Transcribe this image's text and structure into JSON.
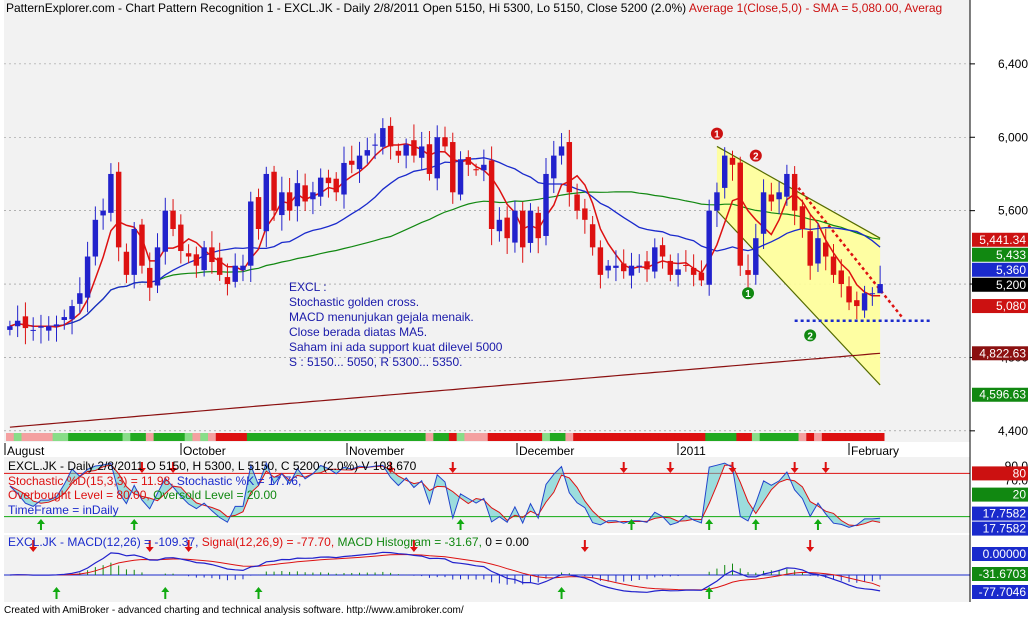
{
  "app": {
    "title": "PatternExplorer.com - Chart Pattern Recognition 1",
    "footer": "Created with AmiBroker - advanced charting and technical analysis software. http://www.amibroker.com/"
  },
  "colors": {
    "background": "#ffffff",
    "plot_bg": "#f2f2f2",
    "axis_bg": "#ffffff",
    "up_candle": "#2222cc",
    "down_candle": "#dd1111",
    "ma5": "#dd1111",
    "ma20": "#1a2acc",
    "ma50": "#118811",
    "ma200": "#8b1010",
    "wedge_fill": "#ffff99",
    "wedge_line": "#556b00",
    "annotation_text": "#1a1aaa",
    "stoch_d": "#dd1111",
    "stoch_k": "#2244cc",
    "stoch_fill": "#55cccc",
    "macd_line": "#2222cc",
    "signal_line": "#dd1111",
    "arrow_up": "#11aa11",
    "arrow_down": "#dd1111"
  },
  "panels": {
    "price": {
      "header": "PatternExplorer.com - Chart Pattern Recognition 1  - EXCL.JK - Daily 2/8/2011 Open 5150, Hi 5300, Lo 5150, Close 5200 (2.0%) ",
      "header_ma": "Average 1(Close,5,0) - SMA = 5,080.00, Averag",
      "annotation": [
        "EXCL :",
        "Stochastic golden cross.",
        "MACD menunjukan gejala menaik.",
        "Close berada diatas MA5.",
        "Saham ini ada support kuat dilevel 5000",
        "S : 5150... 5050, R 5300... 5350."
      ],
      "pattern_markers": [
        "1",
        "2",
        "1",
        "2"
      ],
      "x_labels": [
        "August",
        "October",
        "November",
        "December",
        "2011",
        "February"
      ],
      "y_ticks": [
        "6,400",
        "6,000",
        "5,600",
        "5,200",
        "4,800",
        "4,400"
      ],
      "value_tags": [
        {
          "text": "5,441.34",
          "bg": "#cc1111",
          "fg": "#ffffff"
        },
        {
          "text": "5,433",
          "bg": "#118811",
          "fg": "#ffffff"
        },
        {
          "text": "5,360",
          "bg": "#1a2acc",
          "fg": "#ffffff"
        },
        {
          "text": "5,200",
          "bg": "#000000",
          "fg": "#ffffff"
        },
        {
          "text": "5,080",
          "bg": "#cc1111",
          "fg": "#ffffff"
        },
        {
          "text": "4,822.63",
          "bg": "#8b1010",
          "fg": "#ffffff"
        },
        {
          "text": "4,596.63",
          "bg": "#118811",
          "fg": "#ffffff"
        }
      ]
    },
    "stochastic": {
      "line1": "EXCL.JK - Daily 2/8/2011 O 5150, H 5300, L 5150, C 5200 (2.0%) V 108,670",
      "line2_a": "Stochastic %D(15,3,3) = 11.98,",
      "line2_b": " Stochastic %K = 17.76,",
      "line3_a": "Overbought Level = 80.00,",
      "line3_b": " Oversold Level = 20.00",
      "line4": "TimeFrame = inDaily",
      "y_ticks": [
        "90.0",
        "70.0",
        "50.0"
      ],
      "value_tags": [
        {
          "text": "80",
          "bg": "#cc1111",
          "fg": "#ffffff"
        },
        {
          "text": "20",
          "bg": "#118811",
          "fg": "#ffffff"
        },
        {
          "text": "17.7582",
          "bg": "#1a2acc",
          "fg": "#ffffff"
        },
        {
          "text": "17.7582",
          "bg": "#1a2acc",
          "fg": "#ffffff"
        }
      ]
    },
    "macd": {
      "line1_a": "EXCL.JK - MACD(12,26) = -109.37,",
      "line1_b": " Signal(12,26,9) = -77.70,",
      "line1_c": " MACD Histogram = -31.67,",
      "line1_d": " 0 = 0.00",
      "value_tags": [
        {
          "text": "0.00000",
          "bg": "#1a2acc",
          "fg": "#ffffff"
        },
        {
          "text": "-31.6703",
          "bg": "#118811",
          "fg": "#ffffff"
        },
        {
          "text": "-77.7046",
          "bg": "#1a2acc",
          "fg": "#ffffff"
        }
      ]
    }
  },
  "chart_data": {
    "type": "candlestick",
    "symbol": "EXCL.JK",
    "interval": "Daily",
    "ylim": [
      4350,
      6650
    ],
    "y_ticks": [
      4400,
      4800,
      5200,
      5600,
      6000,
      6400
    ],
    "last_bar": {
      "date": "2/8/2011",
      "open": 5150,
      "high": 5300,
      "low": 5150,
      "close": 5200,
      "change_pct": 2.0,
      "volume": 108670
    },
    "closes": [
      4970,
      5000,
      4960,
      4950,
      4970,
      4970,
      4980,
      5020,
      5080,
      5150,
      5350,
      5550,
      5600,
      5800,
      5400,
      5250,
      5500,
      5300,
      5180,
      5400,
      5600,
      5500,
      5380,
      5350,
      5300,
      5400,
      5320,
      5250,
      5200,
      5300,
      5300,
      5650,
      5500,
      5800,
      5600,
      5700,
      5600,
      5750,
      5650,
      5700,
      5780,
      5750,
      5700,
      5860,
      5850,
      5900,
      5930,
      5960,
      6050,
      5950,
      5900,
      5960,
      5900,
      5950,
      5800,
      6000,
      5950,
      5700,
      5880,
      5850,
      5820,
      5850,
      5500,
      5550,
      5450,
      5600,
      5400,
      5600,
      5450,
      5800,
      5900,
      5950,
      5700,
      5600,
      5550,
      5400,
      5250,
      5300,
      5300,
      5270,
      5300,
      5300,
      5280,
      5400,
      5350,
      5250,
      5280,
      5300,
      5250,
      5220,
      5600,
      5700,
      5900,
      5850,
      5300,
      5250,
      5450,
      5700,
      5650,
      5700,
      5800,
      5600,
      5500,
      5300,
      5450,
      5350,
      5250,
      5200,
      5100,
      5080,
      5150,
      5150,
      5200
    ],
    "sma_last": {
      "ma5": 5080.0,
      "ma20": 5360,
      "ma50": 5433,
      "ma200": 4822.63
    },
    "support": 5000,
    "resistance": [
      5300,
      5350
    ],
    "stochastic": {
      "d_period": [
        15,
        3,
        3
      ],
      "d_last": 11.98,
      "k_last": 17.76,
      "overbought": 80,
      "oversold": 20,
      "ylim": [
        0,
        100
      ],
      "y_ticks": [
        50,
        70,
        90
      ]
    },
    "macd": {
      "fast": 12,
      "slow": 26,
      "signal": 9,
      "macd_last": -109.37,
      "signal_last": -77.7,
      "histogram_last": -31.67
    }
  }
}
